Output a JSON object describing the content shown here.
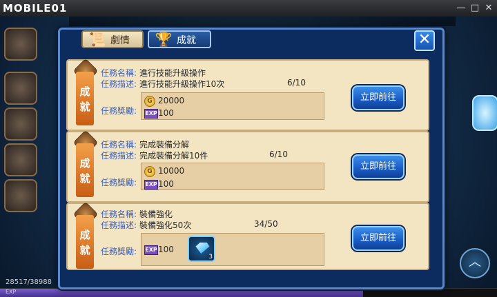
{
  "window": {
    "logo_text": "MOBILE01",
    "controls": [
      "—",
      "□",
      "✕"
    ]
  },
  "game": {
    "exp_text": "28517/38988",
    "exp_label": "EXP",
    "exp_progress": 0.73
  },
  "dialog": {
    "tabs": [
      {
        "label": "劇情",
        "icon": "scroll-icon",
        "active": false
      },
      {
        "label": "成就",
        "icon": "trophy-icon",
        "active": true
      }
    ],
    "close_label": "✕",
    "tasks": [
      {
        "badge": "成\n就",
        "name_label": "任務名稱:",
        "name": "進行技能升級操作",
        "desc_label": "任務描述:",
        "desc": "進行技能升級操作10次",
        "progress": "6/10",
        "reward_label": "任務獎勵:",
        "gold": "20000",
        "exp": "100",
        "exp_icon": "EXP",
        "button": "立即前往"
      },
      {
        "badge": "成\n就",
        "name_label": "任務名稱:",
        "name": "完成裝備分解",
        "desc_label": "任務描述:",
        "desc": "完成裝備分解10件",
        "progress": "6/10",
        "reward_label": "任務獎勵:",
        "gold": "10000",
        "exp": "100",
        "exp_icon": "EXP",
        "button": "立即前往"
      },
      {
        "badge": "成\n就",
        "name_label": "任務名稱:",
        "name": "裝備強化",
        "desc_label": "任務描述:",
        "desc": "裝備強化50次",
        "progress": "34/50",
        "reward_label": "任務獎勵:",
        "exp": "100",
        "exp_icon": "EXP",
        "item_count": "3",
        "button": "立即前往"
      }
    ]
  }
}
